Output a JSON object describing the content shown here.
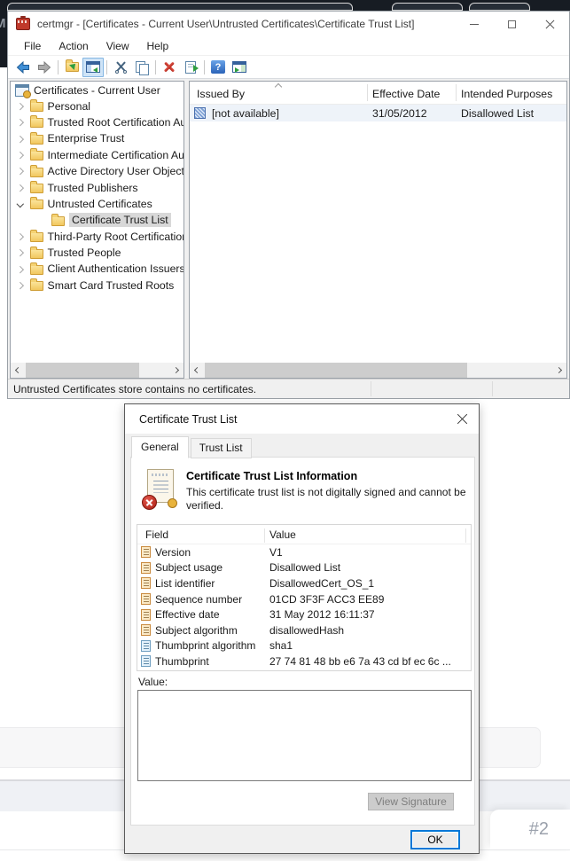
{
  "desktop": {
    "behind_text": "M",
    "watermark": "#2"
  },
  "window": {
    "title": "certmgr - [Certificates - Current User\\Untrusted Certificates\\Certificate Trust List]",
    "menu": {
      "items": [
        "File",
        "Action",
        "View",
        "Help"
      ]
    },
    "toolbar": {
      "help_glyph": "?",
      "icons": [
        "back",
        "forward",
        "up-folder",
        "show-console-tree",
        "cut",
        "copy",
        "delete",
        "export-list",
        "help",
        "show-action-pane"
      ]
    },
    "tree": {
      "root_label": "Certificates - Current User",
      "items": [
        {
          "label": "Personal"
        },
        {
          "label": "Trusted Root Certification Au"
        },
        {
          "label": "Enterprise Trust"
        },
        {
          "label": "Intermediate Certification Au"
        },
        {
          "label": "Active Directory User Object"
        },
        {
          "label": "Trusted Publishers"
        },
        {
          "label": "Untrusted Certificates",
          "expanded": true
        },
        {
          "label": "Certificate Trust List",
          "selected": true
        },
        {
          "label": "Third-Party Root Certification"
        },
        {
          "label": "Trusted People"
        },
        {
          "label": "Client Authentication Issuers"
        },
        {
          "label": "Smart Card Trusted Roots"
        }
      ]
    },
    "list": {
      "columns": [
        "Issued By",
        "Effective Date",
        "Intended Purposes"
      ],
      "row": {
        "issued_by": "[not available]",
        "effective_date": "31/05/2012",
        "intended_purposes": "Disallowed List"
      }
    },
    "status_text": "Untrusted Certificates store contains no certificates."
  },
  "dialog": {
    "title": "Certificate Trust List",
    "tabs": {
      "general": "General",
      "trust_list": "Trust List"
    },
    "info_heading": "Certificate Trust List Information",
    "info_text": "This certificate trust list is not digitally signed and cannot be verified.",
    "fields_table": {
      "col_field": "Field",
      "col_value": "Value",
      "rows": [
        {
          "field": "Version",
          "value": "V1"
        },
        {
          "field": "Subject usage",
          "value": "Disallowed List"
        },
        {
          "field": "List identifier",
          "value": "DisallowedCert_OS_1"
        },
        {
          "field": "Sequence number",
          "value": "01CD 3F3F ACC3 EE89"
        },
        {
          "field": "Effective date",
          "value": "31 May 2012 16:11:37"
        },
        {
          "field": "Subject algorithm",
          "value": "disallowedHash"
        },
        {
          "field": "Thumbprint algorithm",
          "value": "sha1"
        },
        {
          "field": "Thumbprint",
          "value": "27 74 81 48 bb e6 7a 43 cd bf ec 6c ..."
        }
      ]
    },
    "value_label": "Value:",
    "value_text": "",
    "view_signature_label": "View Signature",
    "ok_label": "OK"
  },
  "colors": {
    "accent_blue": "#0078d7",
    "dark_chrome": "#171c23",
    "selection_gray": "#d8d8d8",
    "delete_red": "#c0392b"
  }
}
